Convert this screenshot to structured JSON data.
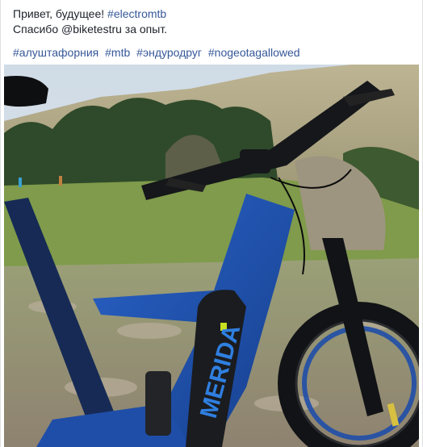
{
  "post": {
    "line1_text": "Привет, будущее!",
    "line1_hashtag": "#electromtb",
    "line2_text": "Спасибо @biketestru за опыт.",
    "hashtags": [
      "#алуштафорния",
      "#mtb",
      "#эндуродруг",
      "#nogeotagallowed"
    ]
  },
  "photo": {
    "icon": "photo-mountain-bike",
    "brand_text": "MERIDA",
    "colors": {
      "sky": "#d9e2ea",
      "hill": "#b7ae8a",
      "trees": "#2f4a2a",
      "grass": "#7e9a4a",
      "rocks": "#a89c88",
      "frame": "#1f4ea8",
      "frame_dark": "#0f2550",
      "black": "#111316",
      "accent": "#c8e020"
    }
  }
}
